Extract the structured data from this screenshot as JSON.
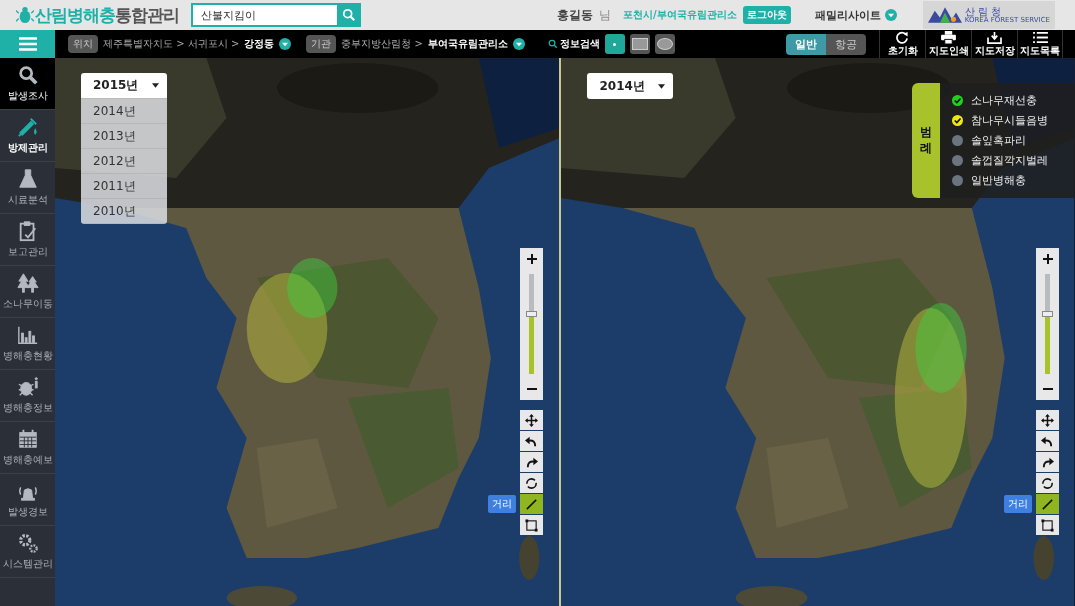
{
  "header": {
    "logo_primary": "산림병해충",
    "logo_secondary": "통합관리",
    "search": {
      "value": "산불지킴이"
    },
    "user_name": "홍길동",
    "user_suffix": "님",
    "user_org": "포천시/부여국유림관리소",
    "logout": "로그아웃",
    "family_site": "패밀리사이트",
    "agency_logo": {
      "name": "산 림 청",
      "subtitle": "KOREA FOREST SERVICE"
    }
  },
  "toolbar": {
    "location": {
      "label": "위치",
      "path": "제주특별자치도 > 서귀포시 >",
      "current": "강정동"
    },
    "agency": {
      "label": "기관",
      "path": "중부지방산림청 >",
      "current": "부여국유림관리소"
    },
    "info_search": "정보검색",
    "shapes": [
      {
        "kind": "point",
        "selected": true
      },
      {
        "kind": "rect",
        "selected": false
      },
      {
        "kind": "ellipse",
        "selected": false
      }
    ],
    "map_types": [
      {
        "label": "일반",
        "selected": true
      },
      {
        "label": "항공",
        "selected": false
      }
    ],
    "tools": [
      {
        "kind": "reset",
        "label": "초기화"
      },
      {
        "kind": "print",
        "label": "지도인쇄"
      },
      {
        "kind": "save",
        "label": "지도저장"
      },
      {
        "kind": "list",
        "label": "지도목록"
      }
    ]
  },
  "sidebar": {
    "items": [
      {
        "kind": "search",
        "label": "발생조사",
        "selected": false,
        "hovered": true
      },
      {
        "kind": "syringe",
        "label": "방제관리",
        "selected": true,
        "hovered": false
      },
      {
        "kind": "flask",
        "label": "시료분석",
        "selected": false,
        "hovered": false
      },
      {
        "kind": "clipboard",
        "label": "보고관리",
        "selected": false,
        "hovered": false
      },
      {
        "kind": "trees",
        "label": "소나무이동",
        "selected": false,
        "hovered": false
      },
      {
        "kind": "chart",
        "label": "병해충현황",
        "selected": false,
        "hovered": false
      },
      {
        "kind": "bug",
        "label": "병해충정보",
        "selected": false,
        "hovered": false
      },
      {
        "kind": "calendar",
        "label": "병해충예보",
        "selected": false,
        "hovered": false
      },
      {
        "kind": "alarm",
        "label": "발생경보",
        "selected": false,
        "hovered": false
      },
      {
        "kind": "gears",
        "label": "시스템관리",
        "selected": false,
        "hovered": false
      }
    ]
  },
  "maps": [
    {
      "year": {
        "value": "2015년",
        "expanded": true,
        "options": [
          "2014년",
          "2013년",
          "2012년",
          "2011년",
          "2010년"
        ]
      },
      "controls": {
        "level": 0.6,
        "tools": [
          {
            "kind": "pan",
            "selected": false
          },
          {
            "kind": "undo",
            "selected": false
          },
          {
            "kind": "redo",
            "selected": false
          },
          {
            "kind": "refresh",
            "selected": false
          },
          {
            "kind": "line",
            "selected": true,
            "tooltip": "거리"
          },
          {
            "kind": "rect",
            "selected": false
          }
        ]
      }
    },
    {
      "year": {
        "value": "2014년",
        "expanded": false
      },
      "legend": {
        "title": "범례",
        "items": [
          {
            "label": "소나무재선충",
            "checked": true,
            "color": "#1ed21e"
          },
          {
            "label": "참나무시들음병",
            "checked": true,
            "color": "#f0e614"
          },
          {
            "label": "솔잎혹파리",
            "checked": false
          },
          {
            "label": "솔껍질깍지벌레",
            "checked": false
          },
          {
            "label": "일반병해충",
            "checked": false
          }
        ]
      },
      "controls": {
        "level": 0.6,
        "tools": [
          {
            "kind": "pan",
            "selected": false
          },
          {
            "kind": "undo",
            "selected": false
          },
          {
            "kind": "redo",
            "selected": false
          },
          {
            "kind": "refresh",
            "selected": false
          },
          {
            "kind": "line",
            "selected": true,
            "tooltip": "거리"
          },
          {
            "kind": "rect",
            "selected": false
          }
        ]
      }
    }
  ]
}
